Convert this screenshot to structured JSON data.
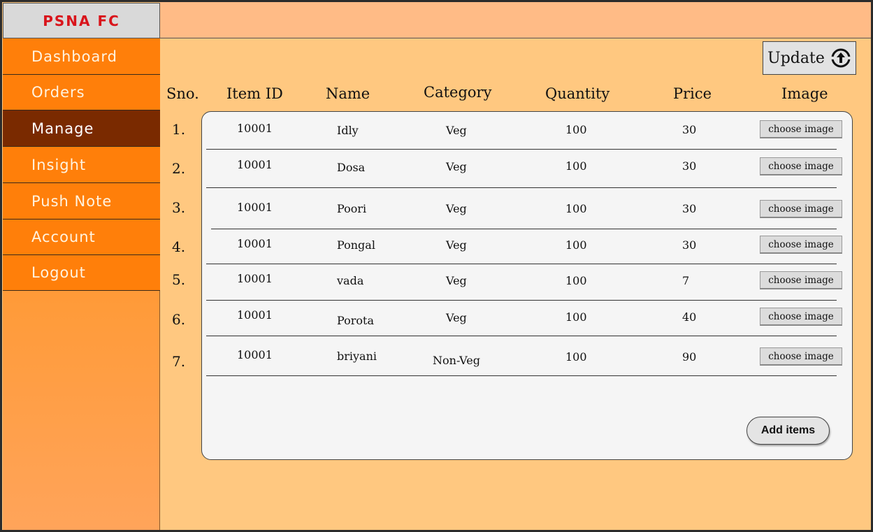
{
  "brand": "PSNA FC",
  "sidebar": {
    "items": [
      {
        "label": "Dashboard",
        "active": false
      },
      {
        "label": "Orders",
        "active": false
      },
      {
        "label": "Manage",
        "active": true
      },
      {
        "label": "Insight",
        "active": false
      },
      {
        "label": "Push Note",
        "active": false
      },
      {
        "label": "Account",
        "active": false
      },
      {
        "label": "Logout",
        "active": false
      }
    ]
  },
  "toolbar": {
    "update_label": "Update",
    "update_icon": "refresh-upload-icon"
  },
  "table": {
    "headers": {
      "sno": "Sno.",
      "item_id": "Item ID",
      "name": "Name",
      "category": "Category",
      "quantity": "Quantity",
      "price": "Price",
      "image": "Image"
    },
    "rows": [
      {
        "sno": "1.",
        "item_id": "10001",
        "name": "Idly",
        "category": "Veg",
        "quantity": "100",
        "price": "30",
        "image_button": "choose image"
      },
      {
        "sno": "2.",
        "item_id": "10001",
        "name": "Dosa",
        "category": "Veg",
        "quantity": "100",
        "price": "30",
        "image_button": "choose image"
      },
      {
        "sno": "3.",
        "item_id": "10001",
        "name": "Poori",
        "category": "Veg",
        "quantity": "100",
        "price": "30",
        "image_button": "choose image"
      },
      {
        "sno": "4.",
        "item_id": "10001",
        "name": "Pongal",
        "category": "Veg",
        "quantity": "100",
        "price": "30",
        "image_button": "choose image"
      },
      {
        "sno": "5.",
        "item_id": "10001",
        "name": "vada",
        "category": "Veg",
        "quantity": "100",
        "price": "7",
        "image_button": "choose image"
      },
      {
        "sno": "6.",
        "item_id": "10001",
        "name": "Porota",
        "category": "Veg",
        "quantity": "100",
        "price": "40",
        "image_button": "choose image"
      },
      {
        "sno": "7.",
        "item_id": "10001",
        "name": "briyani",
        "category": "Non-Veg",
        "quantity": "100",
        "price": "90",
        "image_button": "choose image"
      }
    ]
  },
  "add_items_label": "Add items",
  "colors": {
    "sidebar": "#ff7f0a",
    "sidebar_active": "#7a2a00",
    "main_bg": "#ffc880",
    "topbar": "#ffbb86",
    "brand_text": "#d9141b"
  }
}
